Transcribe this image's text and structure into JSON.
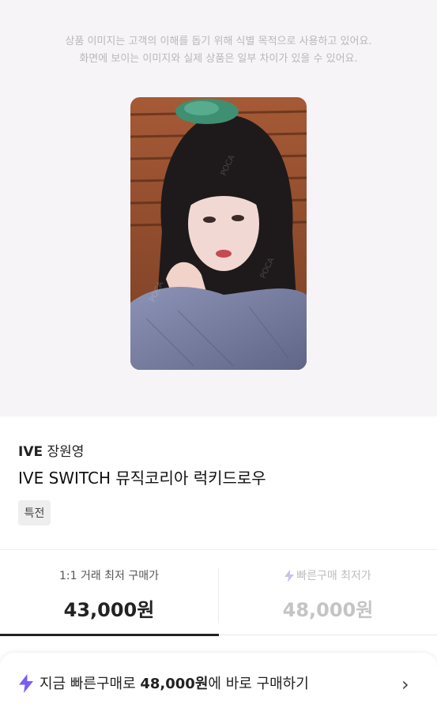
{
  "notice": {
    "line1": "상품 이미지는 고객의 이해를 돕기 위해 식별 목적으로 사용하고 있어요.",
    "line2": "화면에 보이는 이미지와 실제 상품은 일부 차이가 있을 수 있어요."
  },
  "product": {
    "group": "IVE",
    "member": "장원영",
    "title": "IVE SWITCH 뮤직코리아 럭키드로우",
    "tag": "특전",
    "image_icon": "photocard-image"
  },
  "prices": {
    "left_label": "1:1 거래 최저 구매가",
    "left_value": "43,000원",
    "right_label": "빠른구매 최저가",
    "right_value": "48,000원",
    "right_icon": "bolt-icon"
  },
  "cta": {
    "prefix": "지금 빠른구매로 ",
    "amount": "48,000원",
    "suffix": "에 바로 구매하기",
    "icon": "bolt-icon",
    "chevron": "›"
  },
  "colors": {
    "accent_purple": "#7b5cf5",
    "hero_bg": "#f6f4f7"
  }
}
